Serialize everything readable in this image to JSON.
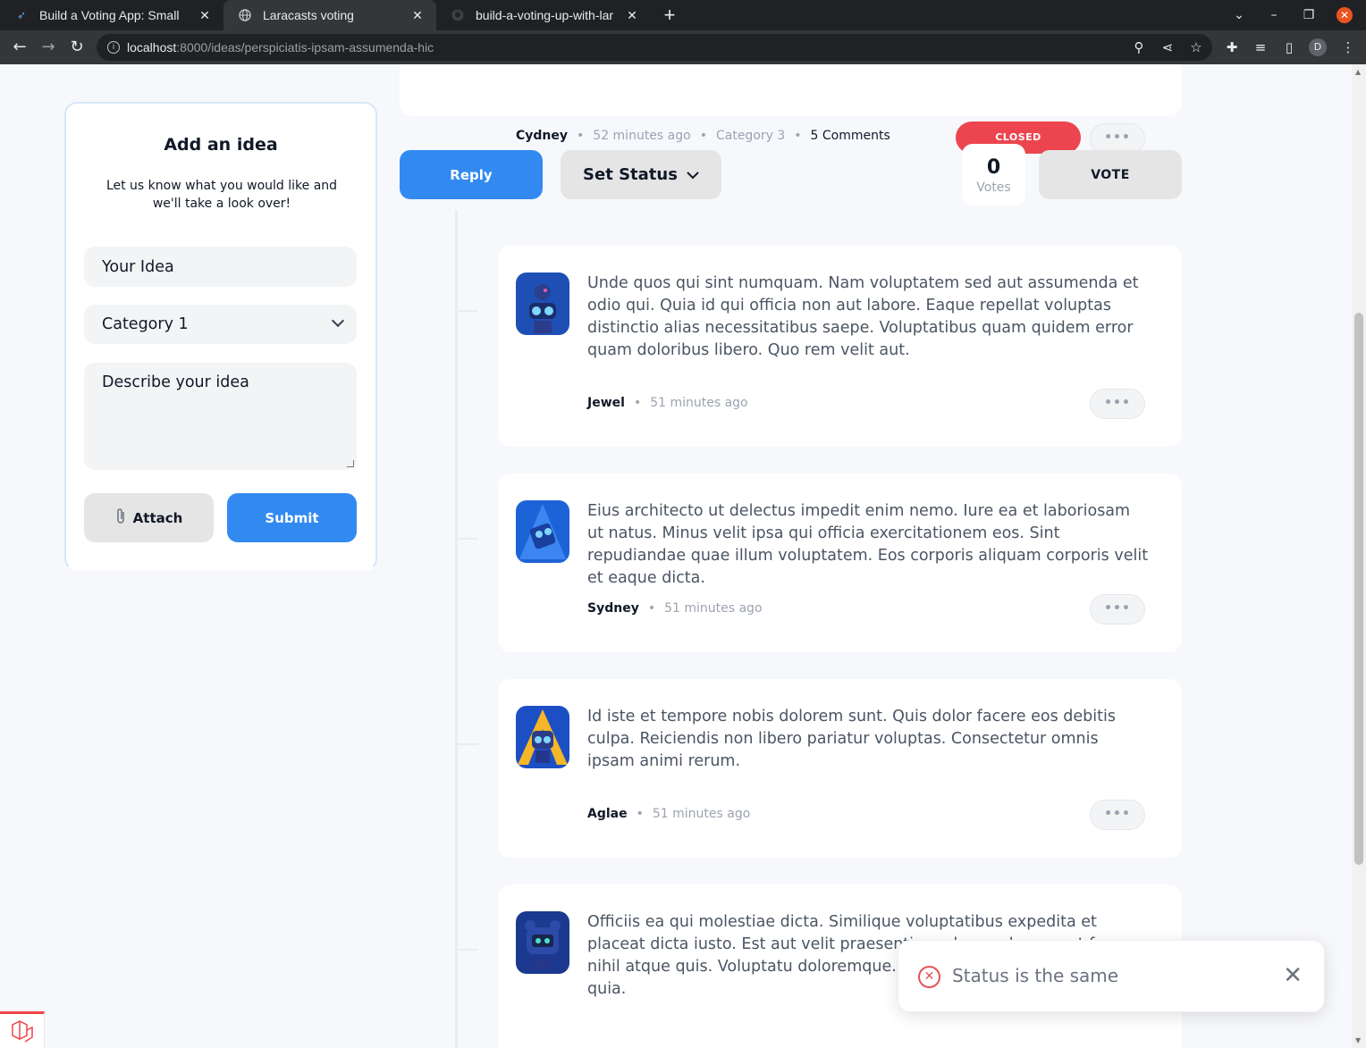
{
  "browser": {
    "tabs": [
      {
        "title": "Build a Voting App: Small",
        "favicon": "laracasts-icon"
      },
      {
        "title": "Laracasts voting",
        "favicon": "globe-icon"
      },
      {
        "title": "build-a-voting-up-with-lar",
        "favicon": "github-icon"
      }
    ],
    "url_host": "localhost",
    "url_path": ":8000/ideas/perspiciatis-ipsam-assumenda-hic",
    "profile_initial": "D"
  },
  "idea": {
    "author": "Cydney",
    "time": "52 minutes ago",
    "category": "Category 3",
    "comments": "5 Comments",
    "status": "CLOSED",
    "status_color": "#ec454f"
  },
  "actions": {
    "reply_label": "Reply",
    "set_status_label": "Set Status",
    "votes_count": "0",
    "votes_label": "Votes",
    "vote_label": "VOTE"
  },
  "add_idea": {
    "title": "Add an idea",
    "subtitle": "Let us know what you would like and we'll take a look over!",
    "title_placeholder": "Your Idea",
    "category_selected": "Category 1",
    "description_placeholder": "Describe your idea",
    "attach_label": "Attach",
    "submit_label": "Submit"
  },
  "comments": [
    {
      "author": "Jewel",
      "time": "51 minutes ago",
      "avatar": "robot-avatar",
      "body": "Unde quos qui sint numquam. Nam voluptatem sed aut assumenda et odio qui. Quia id qui officia non aut labore. Eaque repellat voluptas distinctio alias necessitatibus saepe. Voluptatibus quam quidem error quam doloribus libero. Quo rem velit aut."
    },
    {
      "author": "Sydney",
      "time": "51 minutes ago",
      "avatar": "robot-avatar",
      "body": "Eius architecto ut delectus impedit enim nemo. Iure ea et laboriosam ut natus. Minus velit ipsa qui officia exercitationem eos. Sint repudiandae quae illum voluptatem. Eos corporis aliquam corporis velit et eaque dicta."
    },
    {
      "author": "Aglae",
      "time": "51 minutes ago",
      "avatar": "robot-avatar",
      "body": "Id iste et tempore nobis dolorem sunt. Quis dolor facere eos debitis culpa. Reiciendis non libero pariatur voluptas. Consectetur omnis ipsam animi rerum."
    },
    {
      "author": "",
      "time": "",
      "avatar": "robot-avatar",
      "body": "Officiis ea qui molestiae dicta. Similique voluptatibus expedita et placeat dicta iusto. Est aut velit praesentium ab sus ab quae ut fuga nihil atque quis. Voluptatu doloremque. Harum officia ut eius quia. Do quia."
    }
  ],
  "toast": {
    "message": "Status is the same",
    "type": "error"
  },
  "colors": {
    "primary": "#328af1",
    "closed": "#ec454f",
    "background": "#f7f8fc"
  }
}
